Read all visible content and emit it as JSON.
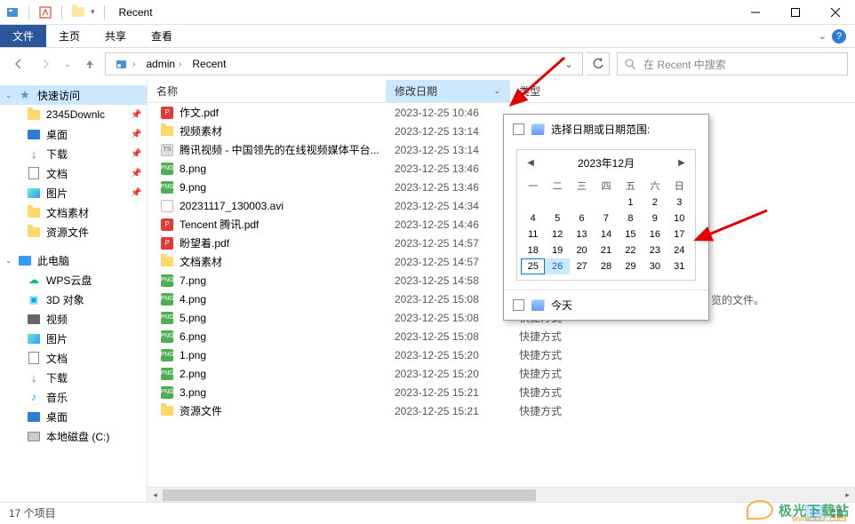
{
  "titlebar": {
    "title": "Recent"
  },
  "ribbon": {
    "file": "文件",
    "home": "主页",
    "share": "共享",
    "view": "查看"
  },
  "breadcrumb": {
    "seg1": "admin",
    "seg2": "Recent"
  },
  "search": {
    "placeholder": "在 Recent 中搜索"
  },
  "sidebar": {
    "quick": "快速访问",
    "items_quick": [
      {
        "label": "2345Downlc"
      },
      {
        "label": "桌面"
      },
      {
        "label": "下载"
      },
      {
        "label": "文档"
      },
      {
        "label": "图片"
      },
      {
        "label": "文档素材"
      },
      {
        "label": "资源文件"
      }
    ],
    "thispc": "此电脑",
    "items_pc": [
      {
        "label": "WPS云盘"
      },
      {
        "label": "3D 对象"
      },
      {
        "label": "视频"
      },
      {
        "label": "图片"
      },
      {
        "label": "文档"
      },
      {
        "label": "下载"
      },
      {
        "label": "音乐"
      },
      {
        "label": "桌面"
      },
      {
        "label": "本地磁盘 (C:)"
      }
    ]
  },
  "columns": {
    "name": "名称",
    "date": "修改日期",
    "type": "类型"
  },
  "files": [
    {
      "icon": "pdf",
      "name": "作文.pdf",
      "date": "2023-12-25 10:46",
      "type": ""
    },
    {
      "icon": "folder",
      "name": "视频素材",
      "date": "2023-12-25 13:14",
      "type": ""
    },
    {
      "icon": "ts",
      "name": "腾讯视频 - 中国领先的在线视频媒体平台...",
      "date": "2023-12-25 13:14",
      "type": ""
    },
    {
      "icon": "png",
      "name": "8.png",
      "date": "2023-12-25 13:46",
      "type": ""
    },
    {
      "icon": "png",
      "name": "9.png",
      "date": "2023-12-25 13:46",
      "type": ""
    },
    {
      "icon": "avi",
      "name": "20231117_130003.avi",
      "date": "2023-12-25 14:34",
      "type": ""
    },
    {
      "icon": "pdf",
      "name": "Tencent 腾讯.pdf",
      "date": "2023-12-25 14:46",
      "type": ""
    },
    {
      "icon": "pdf",
      "name": "盼望着.pdf",
      "date": "2023-12-25 14:57",
      "type": ""
    },
    {
      "icon": "folder",
      "name": "文档素材",
      "date": "2023-12-25 14:57",
      "type": ""
    },
    {
      "icon": "png",
      "name": "7.png",
      "date": "2023-12-25 14:58",
      "type": ""
    },
    {
      "icon": "png",
      "name": "4.png",
      "date": "2023-12-25 15:08",
      "type": "快捷方式"
    },
    {
      "icon": "png",
      "name": "5.png",
      "date": "2023-12-25 15:08",
      "type": "快捷方式"
    },
    {
      "icon": "png",
      "name": "6.png",
      "date": "2023-12-25 15:08",
      "type": "快捷方式"
    },
    {
      "icon": "png",
      "name": "1.png",
      "date": "2023-12-25 15:20",
      "type": "快捷方式"
    },
    {
      "icon": "png",
      "name": "2.png",
      "date": "2023-12-25 15:20",
      "type": "快捷方式"
    },
    {
      "icon": "png",
      "name": "3.png",
      "date": "2023-12-25 15:21",
      "type": "快捷方式"
    },
    {
      "icon": "folder",
      "name": "资源文件",
      "date": "2023-12-25 15:21",
      "type": "快捷方式"
    }
  ],
  "date_popup": {
    "header": "选择日期或日期范围:",
    "month": "2023年12月",
    "dow": [
      "一",
      "二",
      "三",
      "四",
      "五",
      "六",
      "日"
    ],
    "today": "今天",
    "today_day": 25,
    "hl_day": 26
  },
  "trailing": "览的文件。",
  "status": {
    "count": "17 个项目"
  },
  "watermark": {
    "name": "极光下载站",
    "url": "www.xz7.com"
  }
}
